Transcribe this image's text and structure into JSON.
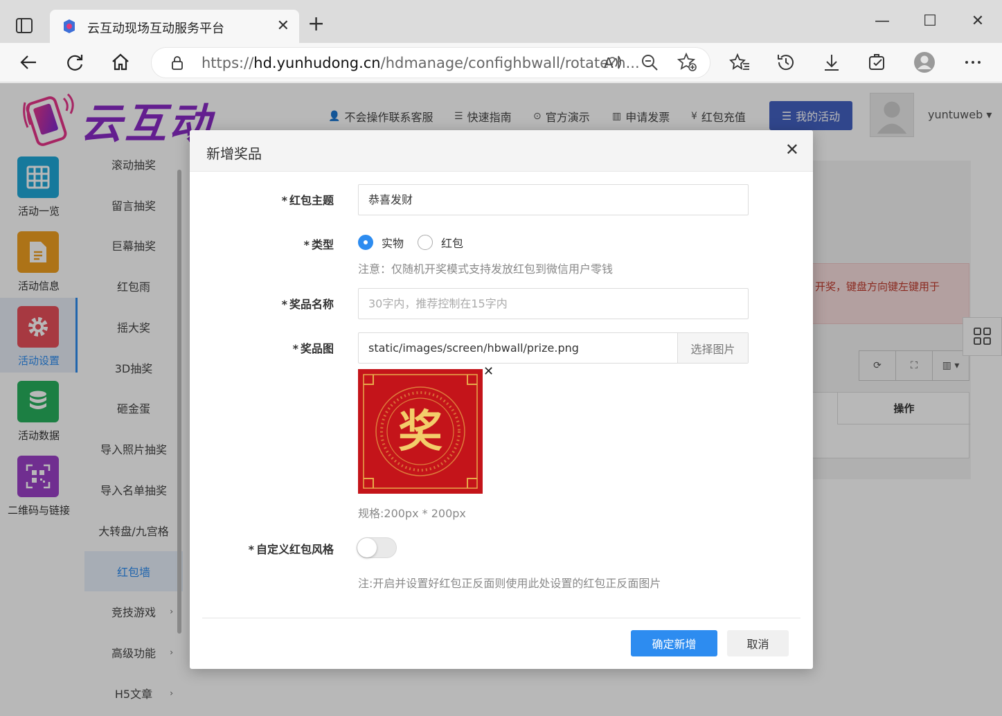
{
  "browser": {
    "tab_title": "云互动现场互动服务平台",
    "url_prefix": "https://",
    "url_host": "hd.yunhudong.cn",
    "url_path": "/hdmanage/confighbwall/rotate?h..."
  },
  "header": {
    "logo_text": "云互动",
    "links": [
      {
        "icon": "user-plus-icon",
        "label": "不会操作联系客服"
      },
      {
        "icon": "list-icon",
        "label": "快速指南"
      },
      {
        "icon": "play-circle-icon",
        "label": "官方演示"
      },
      {
        "icon": "barcode-icon",
        "label": "申请发票"
      },
      {
        "icon": "yen-icon",
        "label": "红包充值"
      }
    ],
    "my_activity": "我的活动",
    "username": "yuntuweb"
  },
  "leftnav": {
    "items": [
      {
        "label": "活动一览",
        "color": "#1fa8d8"
      },
      {
        "label": "活动信息",
        "color": "#f0a020"
      },
      {
        "label": "活动设置",
        "color": "#e8505b"
      },
      {
        "label": "活动数据",
        "color": "#27b15e"
      },
      {
        "label": "二维码与链接",
        "color": "#9b40c8"
      }
    ]
  },
  "subnav": {
    "items": [
      "滚动抽奖",
      "留言抽奖",
      "巨幕抽奖",
      "红包雨",
      "摇大奖",
      "3D抽奖",
      "砸金蛋",
      "导入照片抽奖",
      "导入名单抽奖",
      "大转盘/九宫格",
      "红包墙",
      "竞技游戏",
      "高级功能",
      "H5文章"
    ]
  },
  "background": {
    "alert_text": "开奖，键盘方向键左键用于",
    "table_header": "操作"
  },
  "modal": {
    "title": "新增奖品",
    "theme_label": "红包主题",
    "theme_value": "恭喜发财",
    "type_label": "类型",
    "type_options": [
      "实物",
      "红包"
    ],
    "type_note": "注意：仅随机开奖模式支持发放红包到微信用户零钱",
    "name_label": "奖品名称",
    "name_placeholder": "30字内，推荐控制在15字内",
    "image_label": "奖品图",
    "image_path": "static/images/screen/hbwall/prize.png",
    "image_pick": "选择图片",
    "image_spec": "规格:200px * 200px",
    "prize_char": "奖",
    "custom_label": "自定义红包风格",
    "custom_note": "注:开启并设置好红包正反面则使用此处设置的红包正反面图片",
    "confirm": "确定新增",
    "cancel": "取消"
  }
}
